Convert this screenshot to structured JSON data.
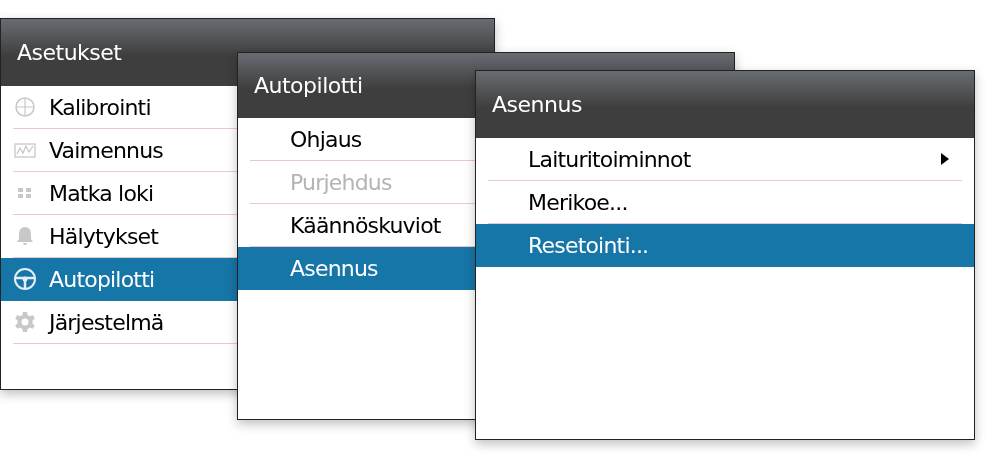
{
  "menus": [
    {
      "title": "Asetukset",
      "items": [
        {
          "label": "Kalibrointi",
          "selected": false
        },
        {
          "label": "Vaimennus",
          "selected": false
        },
        {
          "label": "Matka loki",
          "selected": false
        },
        {
          "label": "Hälytykset",
          "selected": false
        },
        {
          "label": "Autopilotti",
          "selected": true
        },
        {
          "label": "Järjestelmä",
          "selected": false
        }
      ]
    },
    {
      "title": "Autopilotti",
      "items": [
        {
          "label": "Ohjaus",
          "selected": false,
          "disabled": false
        },
        {
          "label": "Purjehdus",
          "selected": false,
          "disabled": true
        },
        {
          "label": "Käännöskuviot",
          "selected": false,
          "disabled": false
        },
        {
          "label": "Asennus",
          "selected": true,
          "disabled": false
        }
      ]
    },
    {
      "title": "Asennus",
      "items": [
        {
          "label": "Laituritoiminnot",
          "selected": false,
          "submenu": true
        },
        {
          "label": "Merikoe...",
          "selected": false,
          "submenu": false
        },
        {
          "label": "Resetointi...",
          "selected": true,
          "submenu": false
        }
      ]
    }
  ]
}
